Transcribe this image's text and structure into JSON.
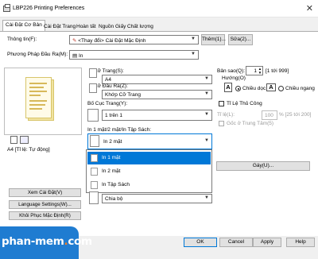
{
  "window": {
    "title": "LBP226 Printing Preferences",
    "close_glyph": "✕"
  },
  "tabs": [
    "Cài Đặt Cơ Bản",
    "Cài Đặt Trang",
    "Hoàn tất",
    "Nguồn Giấy",
    "Chất lượng"
  ],
  "profile": {
    "label": "Thông tin(F):",
    "value": "<Thay đổi> Cài Đặt Mặc Định",
    "add_button": "Thêm(1)...",
    "edit_button": "Sửa(2)..."
  },
  "output_method": {
    "label": "Phương Pháp Đầu Ra(M):",
    "value": "In"
  },
  "preview": {
    "caption": "A4 [Tỉ lệ: Tự động]"
  },
  "page_size": {
    "label": "Cỡ Trang(S):",
    "value": "A4"
  },
  "output_size": {
    "label": "Cỡ Đầu Ra(Z):",
    "value": "Khớp Cỡ Trang"
  },
  "layout": {
    "label": "Bố Cục Trang(Y):",
    "value": "1 trên 1"
  },
  "copies": {
    "label": "Bản sao(Q):",
    "value": "1",
    "range": "[1 tới 999]"
  },
  "orientation": {
    "label": "Hướng(O)",
    "portrait": "Chiều dọc",
    "landscape": "Chiều ngang",
    "portrait_glyph": "A",
    "landscape_glyph": "A"
  },
  "manual_scaling": {
    "label": "Tỉ Lệ Thủ Công",
    "scale_label": "Tỉ lệ(L):",
    "scale_value": "100",
    "scale_unit": "% [25 tới 200]"
  },
  "center_origin": {
    "label": "Gốc ở Trung Tâm(5)"
  },
  "duplex": {
    "label": "In 1 mặt/2 mặt/In Tập Sách:",
    "value": "In 2 mặt",
    "options": [
      "In 1 mặt",
      "In 2 mặt",
      "In Tập Sách"
    ],
    "selected": "In 1 mặt"
  },
  "staple": {
    "button": "Gáy(U)..."
  },
  "collate": {
    "value": "Chia bộ"
  },
  "side_buttons": [
    "Xem Cài Đặt(V)",
    "Language Settings(W)...",
    "Khôi Phục Mặc Định(R)"
  ],
  "footer": {
    "ok": "OK",
    "cancel": "Cancel",
    "apply": "Apply",
    "help": "Help"
  },
  "watermark": {
    "brand": "phan-mem",
    "dot": ".",
    "tld": "com"
  },
  "colors": {
    "accent": "#0078d7",
    "brand": "#1f7cd1",
    "brand_orange": "#f47b20"
  }
}
